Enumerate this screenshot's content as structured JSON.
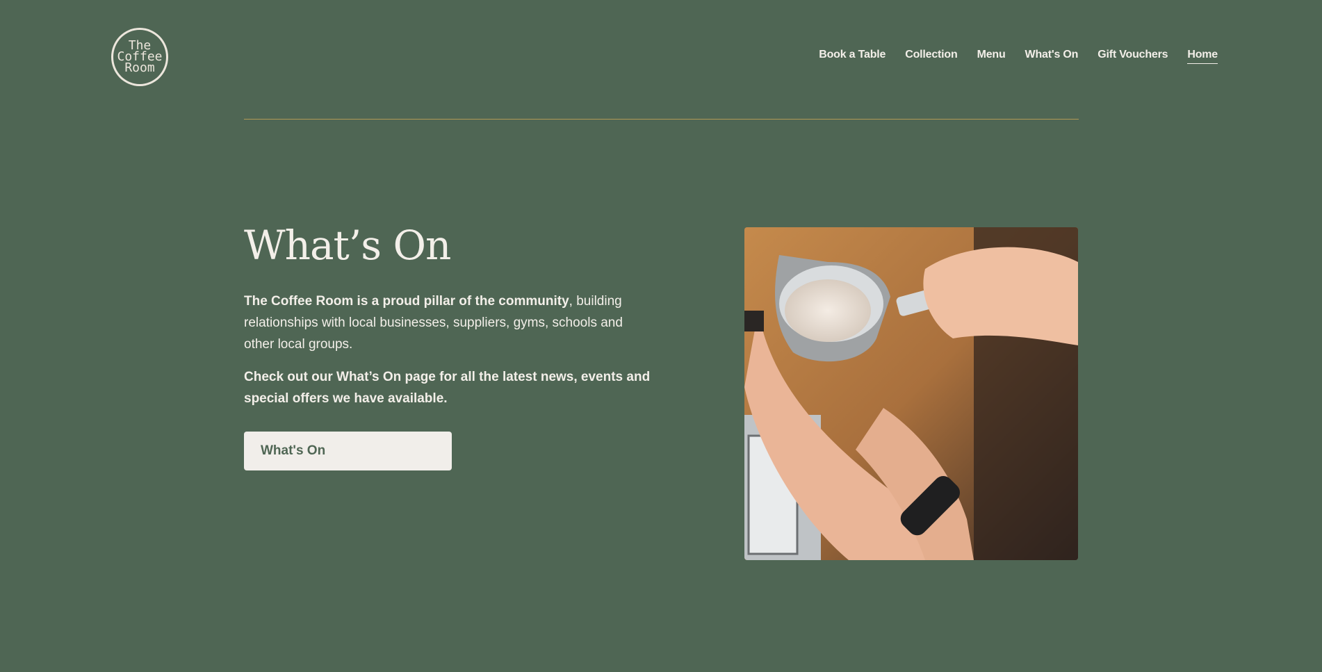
{
  "logo": {
    "line1": "The",
    "line2": "Coffee",
    "line3": "Room"
  },
  "nav": {
    "items": [
      "Book a Table",
      "Collection",
      "Menu",
      "What's On",
      "Gift Vouchers",
      "Home"
    ]
  },
  "hero": {
    "title": "What’s On",
    "intro_bold": "The Coffee Room is a proud pillar of the community",
    "intro_rest": ", building relationships with local businesses, suppliers, gyms, schools and other local groups.",
    "cta_text": "Check out our What’s On page for all the latest news, events and special offers we have available.",
    "button_label": "What's On"
  },
  "colors": {
    "background": "#4f6654",
    "text": "#f3efe9",
    "divider": "#b39a55",
    "button_bg": "#f1eeea"
  }
}
